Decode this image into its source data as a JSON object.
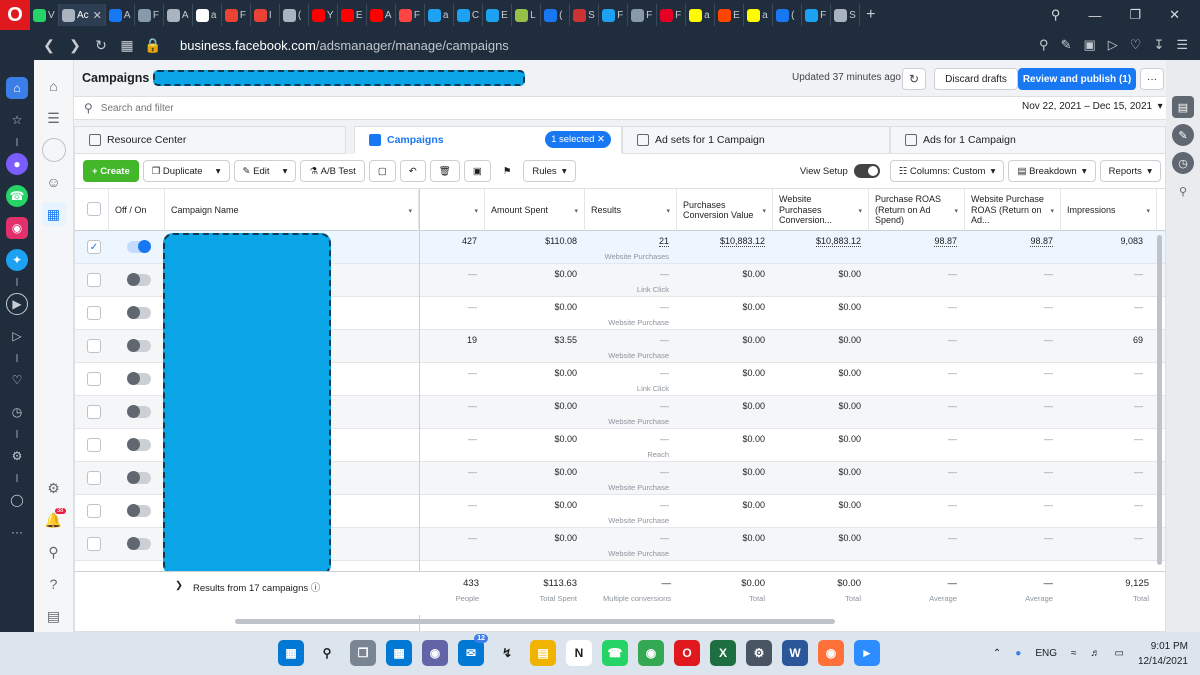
{
  "browser": {
    "url_host": "business.facebook.com",
    "url_path": "/adsmanager/manage/campaigns",
    "tabs": [
      {
        "label": "V",
        "color": "#25d366",
        "active": false
      },
      {
        "label": "Ac",
        "color": "#aab4c0",
        "active": true
      },
      {
        "label": "A",
        "color": "#1877f2",
        "active": false
      },
      {
        "label": "F",
        "color": "#8899aa",
        "active": false
      },
      {
        "label": "A",
        "color": "#aab4c0",
        "active": false
      },
      {
        "label": "a",
        "color": "#ffffff",
        "active": false
      },
      {
        "label": "F",
        "color": "#ea4335",
        "active": false
      },
      {
        "label": "I",
        "color": "#ea4335",
        "active": false
      },
      {
        "label": "(",
        "color": "#aab4c0",
        "active": false
      },
      {
        "label": "Y",
        "color": "#ff0000",
        "active": false
      },
      {
        "label": "E",
        "color": "#ff0000",
        "active": false
      },
      {
        "label": "A",
        "color": "#ff0000",
        "active": false
      },
      {
        "label": "F",
        "color": "#ff4444",
        "active": false
      },
      {
        "label": "a",
        "color": "#1da1f2",
        "active": false
      },
      {
        "label": "C",
        "color": "#1da1f2",
        "active": false
      },
      {
        "label": "E",
        "color": "#1da1f2",
        "active": false
      },
      {
        "label": "L",
        "color": "#96bf48",
        "active": false
      },
      {
        "label": "(",
        "color": "#1877f2",
        "active": false
      },
      {
        "label": "S",
        "color": "#cc3333",
        "active": false
      },
      {
        "label": "F",
        "color": "#1da1f2",
        "active": false
      },
      {
        "label": "F",
        "color": "#8899aa",
        "active": false
      },
      {
        "label": "F",
        "color": "#e60023",
        "active": false
      },
      {
        "label": "a",
        "color": "#fffc00",
        "active": false
      },
      {
        "label": "E",
        "color": "#ff4500",
        "active": false
      },
      {
        "label": "a",
        "color": "#fffc00",
        "active": false
      },
      {
        "label": "(",
        "color": "#1877f2",
        "active": false
      },
      {
        "label": "F",
        "color": "#1da1f2",
        "active": false
      },
      {
        "label": "S",
        "color": "#aab4c0",
        "active": false
      }
    ]
  },
  "header": {
    "title": "Campaigns",
    "updated": "Updated 37 minutes ago",
    "discard": "Discard drafts",
    "publish": "Review and publish (1)",
    "more": "···"
  },
  "search": {
    "placeholder": "Search and filter",
    "date_range": "Nov 22, 2021 – Dec 15, 2021"
  },
  "tabs": {
    "resource_center": "Resource Center",
    "campaigns": "Campaigns",
    "selected_badge": "1 selected",
    "ad_sets": "Ad sets for 1 Campaign",
    "ads": "Ads for 1 Campaign"
  },
  "toolbar": {
    "create": "Create",
    "duplicate": "Duplicate",
    "edit": "Edit",
    "ab_test": "A/B Test",
    "rules": "Rules",
    "view_setup": "View Setup",
    "columns": "Columns: Custom",
    "breakdown": "Breakdown",
    "reports": "Reports"
  },
  "table": {
    "headers": {
      "off_on": "Off / On",
      "campaign_name": "Campaign Name",
      "amount_spent": "Amount Spent",
      "results": "Results",
      "purchases_value": "Purchases Conversion Value",
      "website_purchases": "Website Purchases Conversion...",
      "purchase_roas": "Purchase ROAS (Return on Ad Spend)",
      "website_roas": "Website Purchase ROAS (Return on Ad...",
      "impressions": "Impressions"
    },
    "rows": [
      {
        "checked": true,
        "on": true,
        "a": "427",
        "spent": "$110.08",
        "result": "21",
        "result_type": "Website Purchases",
        "pcv": "$10,883.12",
        "wpcv": "$10,883.12",
        "proas": "98.87",
        "wroas": "98.87",
        "impr": "9,083"
      },
      {
        "checked": false,
        "on": false,
        "a": "—",
        "spent": "$0.00",
        "result": "—",
        "result_type": "Link Click",
        "pcv": "$0.00",
        "wpcv": "$0.00",
        "proas": "—",
        "wroas": "—",
        "impr": "—"
      },
      {
        "checked": false,
        "on": false,
        "a": "—",
        "spent": "$0.00",
        "result": "—",
        "result_type": "Website Purchase",
        "pcv": "$0.00",
        "wpcv": "$0.00",
        "proas": "—",
        "wroas": "—",
        "impr": "—"
      },
      {
        "checked": false,
        "on": false,
        "a": "19",
        "spent": "$3.55",
        "result": "—",
        "result_type": "Website Purchase",
        "pcv": "$0.00",
        "wpcv": "$0.00",
        "proas": "—",
        "wroas": "—",
        "impr": "69"
      },
      {
        "checked": false,
        "on": false,
        "a": "—",
        "spent": "$0.00",
        "result": "—",
        "result_type": "Link Click",
        "pcv": "$0.00",
        "wpcv": "$0.00",
        "proas": "—",
        "wroas": "—",
        "impr": "—"
      },
      {
        "checked": false,
        "on": false,
        "a": "—",
        "spent": "$0.00",
        "result": "—",
        "result_type": "Website Purchase",
        "pcv": "$0.00",
        "wpcv": "$0.00",
        "proas": "—",
        "wroas": "—",
        "impr": "—"
      },
      {
        "checked": false,
        "on": false,
        "a": "—",
        "spent": "$0.00",
        "result": "—",
        "result_type": "Reach",
        "pcv": "$0.00",
        "wpcv": "$0.00",
        "proas": "—",
        "wroas": "—",
        "impr": "—"
      },
      {
        "checked": false,
        "on": false,
        "a": "—",
        "spent": "$0.00",
        "result": "—",
        "result_type": "Website Purchase",
        "pcv": "$0.00",
        "wpcv": "$0.00",
        "proas": "—",
        "wroas": "—",
        "impr": "—"
      },
      {
        "checked": false,
        "on": false,
        "a": "—",
        "spent": "$0.00",
        "result": "—",
        "result_type": "Website Purchase",
        "pcv": "$0.00",
        "wpcv": "$0.00",
        "proas": "—",
        "wroas": "—",
        "impr": "—"
      },
      {
        "checked": false,
        "on": false,
        "a": "—",
        "spent": "$0.00",
        "result": "—",
        "result_type": "Website Purchase",
        "pcv": "$0.00",
        "wpcv": "$0.00",
        "proas": "—",
        "wroas": "—",
        "impr": "—"
      }
    ],
    "footer": {
      "label": "Results from 17 campaigns",
      "a": "433",
      "a_sub": "People",
      "spent": "$113.63",
      "spent_sub": "Total Spent",
      "result": "—",
      "result_sub": "Multiple conversions",
      "pcv": "$0.00",
      "pcv_sub": "Total",
      "wpcv": "$0.00",
      "wpcv_sub": "Total",
      "proas": "—",
      "proas_sub": "Average",
      "wroas": "—",
      "wroas_sub": "Average",
      "impr": "9,125",
      "impr_sub": "Total"
    }
  },
  "taskbar": {
    "lang": "ENG",
    "time": "9:01 PM",
    "date": "12/14/2021",
    "mail_badge": "12"
  }
}
